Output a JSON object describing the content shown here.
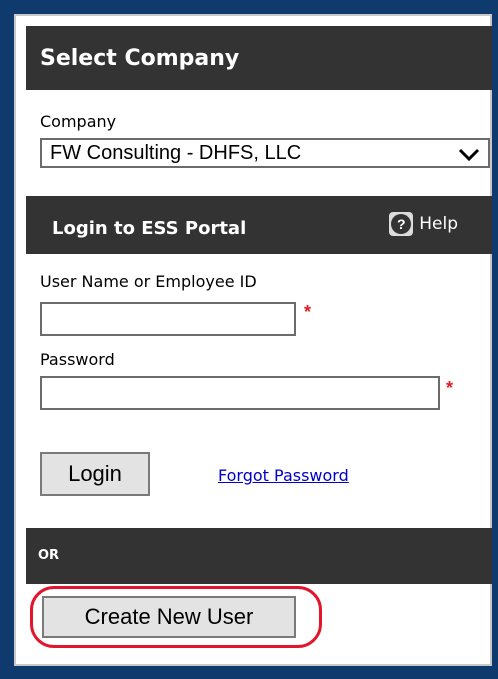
{
  "select_company": {
    "header": "Select Company",
    "company_label": "Company",
    "company_value": "FW Consulting - DHFS, LLC"
  },
  "login": {
    "header": "Login to ESS Portal",
    "help_label": "Help",
    "help_icon": "question-circle-icon",
    "username_label": "User Name or Employee ID",
    "username_value": "",
    "password_label": "Password",
    "password_value": "",
    "required_mark": "*",
    "login_button": "Login",
    "forgot_password": "Forgot Password"
  },
  "or_bar": {
    "label": "OR"
  },
  "create_user": {
    "button": "Create New User"
  },
  "colors": {
    "frame_blue": "#0f3a6e",
    "header_dark": "#333333",
    "required_red": "#e31b23",
    "highlight_red": "#e3142b",
    "link_blue": "#0000cc"
  }
}
